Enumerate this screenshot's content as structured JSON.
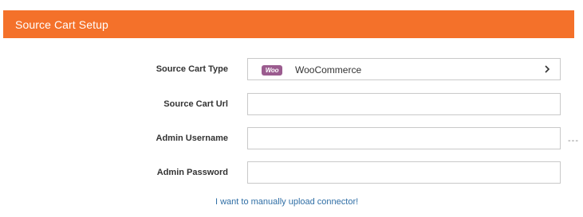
{
  "header": {
    "title": "Source Cart Setup"
  },
  "form": {
    "source_cart_type": {
      "label": "Source Cart Type",
      "logo_text": "Woo",
      "value": "WooCommerce"
    },
    "source_cart_url": {
      "label": "Source Cart Url",
      "value": "",
      "placeholder": ""
    },
    "admin_username": {
      "label": "Admin Username",
      "value": "",
      "placeholder": ""
    },
    "admin_password": {
      "label": "Admin Password",
      "value": "",
      "placeholder": ""
    }
  },
  "overflow_indicator": "---",
  "manual_upload_link": "I want to manually upload connector!",
  "colors": {
    "header_bg": "#f4712a",
    "woo_brand": "#9b5c8f",
    "link": "#2f6ea5"
  },
  "icons": {
    "select_chevron": "chevron-right-icon",
    "platform_logo": "woocommerce-logo-icon"
  }
}
